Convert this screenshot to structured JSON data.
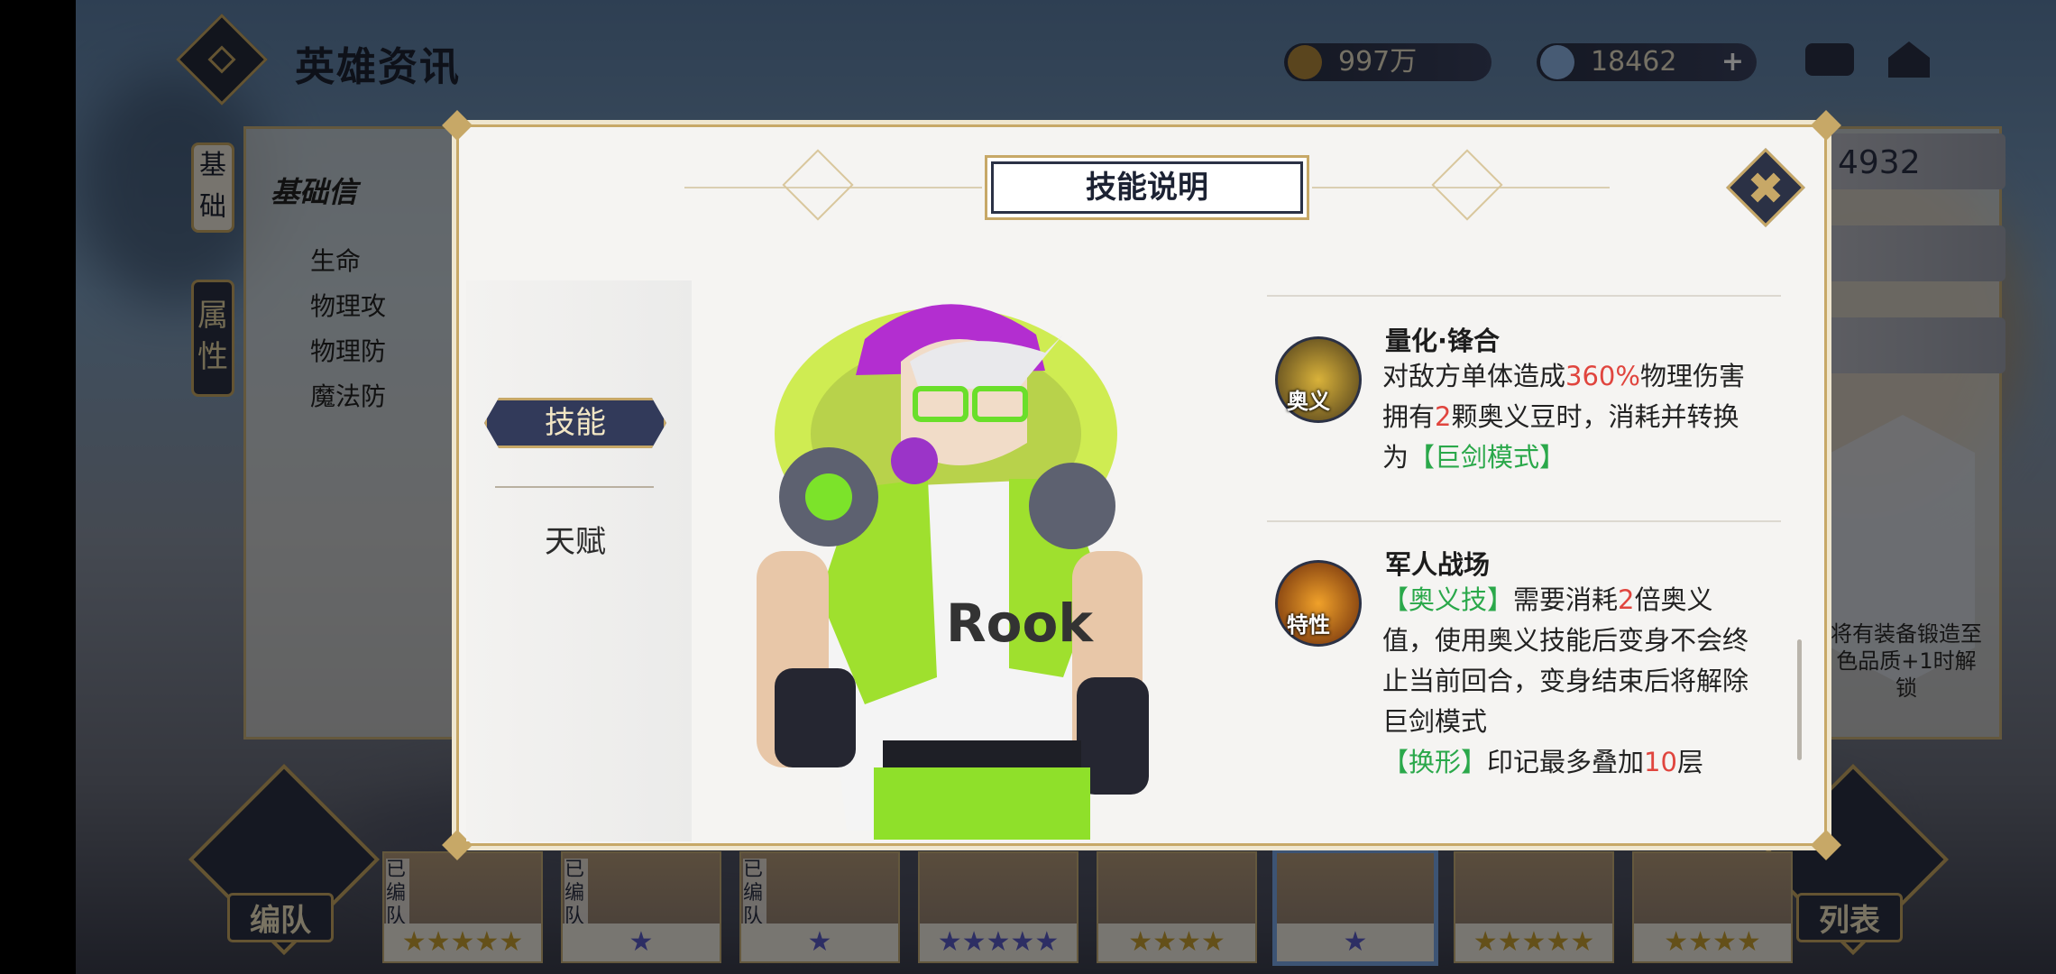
{
  "header": {
    "title": "英雄资讯"
  },
  "resources": {
    "gold": "997万",
    "diamond": "18462",
    "diamond_plus": "+"
  },
  "side_tabs": {
    "base": "基础",
    "attr": "属性"
  },
  "base_info": {
    "title": "基础信",
    "stats": [
      "生命",
      "物理攻",
      "物理防",
      "魔法防"
    ]
  },
  "right_panel": {
    "number": "4932",
    "lock_text_1": "将有装备锻造至",
    "lock_text_2": "色品质+1时解",
    "lock_text_3": "锁"
  },
  "bottom": {
    "team_label": "编队",
    "list_label": "列表"
  },
  "roster": {
    "labels": [
      "已编队",
      "已编队",
      "已编队"
    ],
    "stars": [
      {
        "stars": "★★★★★",
        "color": "gold"
      },
      {
        "stars": "★",
        "color": "blue"
      },
      {
        "stars": "★",
        "color": "blue"
      },
      {
        "stars": "★★★★★",
        "color": "blue"
      },
      {
        "stars": "★★★★",
        "color": "gold"
      },
      {
        "stars": "★",
        "color": "blue"
      },
      {
        "stars": "★★★★★",
        "color": "gold"
      },
      {
        "stars": "★★★★",
        "color": "gold"
      }
    ]
  },
  "modal": {
    "title": "技能说明",
    "tabs": {
      "active": "技能",
      "inactive": "天赋"
    },
    "skills": [
      {
        "name": "量化·锋合",
        "tag": "奥义",
        "lines": [
          [
            {
              "t": "对敌方单体造成"
            },
            {
              "t": "360%",
              "c": "red"
            },
            {
              "t": "物理伤害"
            }
          ],
          [
            {
              "t": "拥有"
            },
            {
              "t": "2",
              "c": "red"
            },
            {
              "t": "颗奥义豆时，消耗并转换"
            }
          ],
          [
            {
              "t": "为"
            },
            {
              "t": "【巨剑模式】",
              "c": "green"
            }
          ]
        ]
      },
      {
        "name": "军人战场",
        "tag": "特性",
        "lines": [
          [
            {
              "t": "【奥义技】",
              "c": "green"
            },
            {
              "t": "需要消耗"
            },
            {
              "t": "2",
              "c": "red"
            },
            {
              "t": "倍奥义"
            }
          ],
          [
            {
              "t": "值，使用奥义技能后变身不会终"
            }
          ],
          [
            {
              "t": "止当前回合，变身结束后将解除"
            }
          ],
          [
            {
              "t": "巨剑模式"
            }
          ],
          [
            {
              "t": "【换形】",
              "c": "green"
            },
            {
              "t": "印记最多叠加"
            },
            {
              "t": "10",
              "c": "red"
            },
            {
              "t": "层"
            }
          ]
        ]
      }
    ]
  },
  "colors": {
    "accent_gold": "#c7a867",
    "navy": "#2b3145",
    "highlight_red": "#e0453e",
    "highlight_green": "#2aa84a"
  }
}
